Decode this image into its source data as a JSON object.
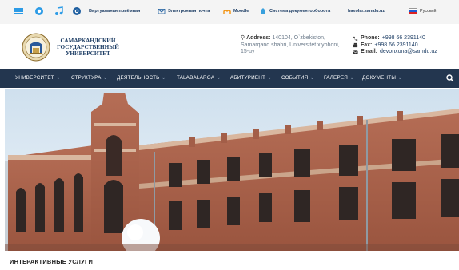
{
  "topbar": {
    "links": [
      {
        "label": "Виртуальная приёмная",
        "icon": "virtual-reception-icon"
      },
      {
        "label": "Электронная почта",
        "icon": "mail-icon"
      },
      {
        "label": "Moodle",
        "icon": "moodle-icon"
      },
      {
        "label": "Система документооборота",
        "icon": "document-flow-icon"
      },
      {
        "label": "baxolar.samdu.uz",
        "icon": ""
      }
    ],
    "language": "Русский",
    "social_icons": [
      "menu-icon",
      "globe-icon",
      "music-icon",
      "eye-icon"
    ]
  },
  "header": {
    "name_line1": "САМАРКАНДСКИЙ",
    "name_line2": "ГОСУДАРСТВЕННЫЙ",
    "name_line3": "УНИВЕРСИТЕТ",
    "address_label": "Address:",
    "address_value": "140104, O`zbekiston, Samarqand shahri, Universitet xiyoboni, 15-uy",
    "phone_label": "Phone:",
    "phone_value": "+998 66 2391140",
    "fax_label": "Fax:",
    "fax_value": "+998 66 2391140",
    "email_label": "Email:",
    "email_value": "devonxona@samdu.uz"
  },
  "nav": {
    "items": [
      "УНИВЕРСИТЕТ",
      "СТРУКТУРА",
      "ДЕЯТЕЛЬНОСТЬ",
      "TALABALARGA",
      "АБИТУРИЕНТ",
      "СОБЫТИЯ",
      "ГАЛЕРЕЯ",
      "ДОКУМЕНТЫ"
    ]
  },
  "section": {
    "title": "ИНТЕРАКТИВНЫЕ УСЛУГИ"
  },
  "colors": {
    "nav_bg": "#23364f",
    "brand": "#1f3f66",
    "building_brick": "#a9614b"
  }
}
